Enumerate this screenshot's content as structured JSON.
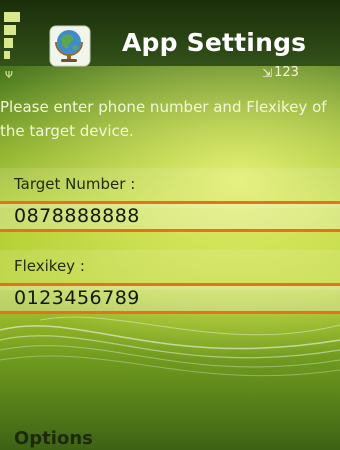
{
  "header": {
    "title": "App Settings",
    "signal_icon": "signal-bars-icon",
    "app_icon": "globe-icon",
    "network_label": "123"
  },
  "instruction": "Please enter phone number and Flexikey of the target device.",
  "form": {
    "target_number": {
      "label": "Target Number :",
      "value": "0878888888"
    },
    "flexikey": {
      "label": "Flexikey :",
      "value": "0123456789"
    }
  },
  "softkeys": {
    "left": "Options"
  },
  "colors": {
    "focus_border": "#e8711b",
    "title_bar": "#1b2e0a",
    "background_light": "#b8d232"
  }
}
